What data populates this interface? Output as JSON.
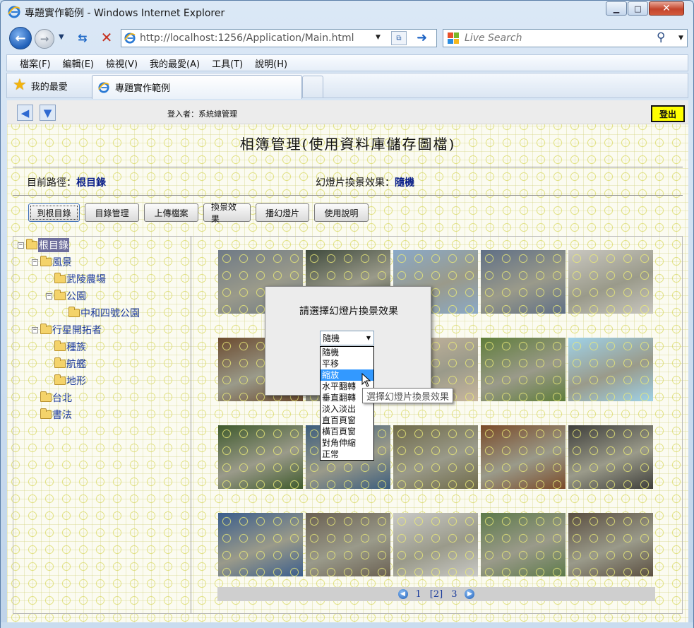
{
  "window": {
    "title": "專題實作範例 - Windows Internet Explorer",
    "url": "http://localhost:1256/Application/Main.html",
    "search_placeholder": "Live Search"
  },
  "menu": [
    "檔案(F)",
    "編輯(E)",
    "檢視(V)",
    "我的最愛(A)",
    "工具(T)",
    "說明(H)"
  ],
  "favorites_label": "我的最愛",
  "tab_title": "專題實作範例",
  "page": {
    "login_label": "登入者：系統總管理",
    "logout": "登出",
    "title": "相簿管理(使用資料庫儲存圖檔)",
    "path_label": "目前路徑：",
    "path_value": "根目錄",
    "effect_label": "幻燈片換景效果：",
    "effect_value": "隨機",
    "actions": [
      "到根目錄",
      "目錄管理",
      "上傳檔案",
      "換景效果",
      "播幻燈片",
      "使用說明"
    ]
  },
  "tree": [
    {
      "label": "根目錄",
      "level": 0,
      "expander": "-",
      "selected": true
    },
    {
      "label": "風景",
      "level": 1,
      "expander": "-"
    },
    {
      "label": "武陵農場",
      "level": 2,
      "expander": ""
    },
    {
      "label": "公園",
      "level": 2,
      "expander": "-"
    },
    {
      "label": "中和四號公園",
      "level": 3,
      "expander": ""
    },
    {
      "label": "行星開拓者",
      "level": 1,
      "expander": "-"
    },
    {
      "label": "種族",
      "level": 2,
      "expander": ""
    },
    {
      "label": "航艦",
      "level": 2,
      "expander": ""
    },
    {
      "label": "地形",
      "level": 2,
      "expander": ""
    },
    {
      "label": "台北",
      "level": 1,
      "expander": ""
    },
    {
      "label": "書法",
      "level": 1,
      "expander": ""
    }
  ],
  "thumbnail_colors": [
    [
      "#6f7a86",
      "#3f4a3c",
      "#8aa9c8",
      "#5f6f86",
      "#c9c7c0"
    ],
    [
      "#6b4a2e",
      "#4d4a40",
      "#c9b79e",
      "#5f7d3a",
      "#9fd2e8"
    ],
    [
      "#3f5a2c",
      "#3c5d7d",
      "#6f6a48",
      "#7a4a28",
      "#3e3e3a"
    ],
    [
      "#3a5d8c",
      "#6a6052",
      "#c9c9c6",
      "#5d7a4a",
      "#5a4e40"
    ]
  ],
  "pager": {
    "current": "[2]",
    "pages": [
      "1",
      "3"
    ]
  },
  "dialog": {
    "title": "請選擇幻燈片換景效果",
    "selected": "隨機",
    "options": [
      "隨機",
      "平移",
      "縮放",
      "水平翻轉",
      "垂直翻轉",
      "淡入淡出",
      "直百頁窗",
      "橫百頁窗",
      "對角伸縮",
      "正常"
    ],
    "hover_index": 2,
    "tooltip": "選擇幻燈片換景效果"
  }
}
